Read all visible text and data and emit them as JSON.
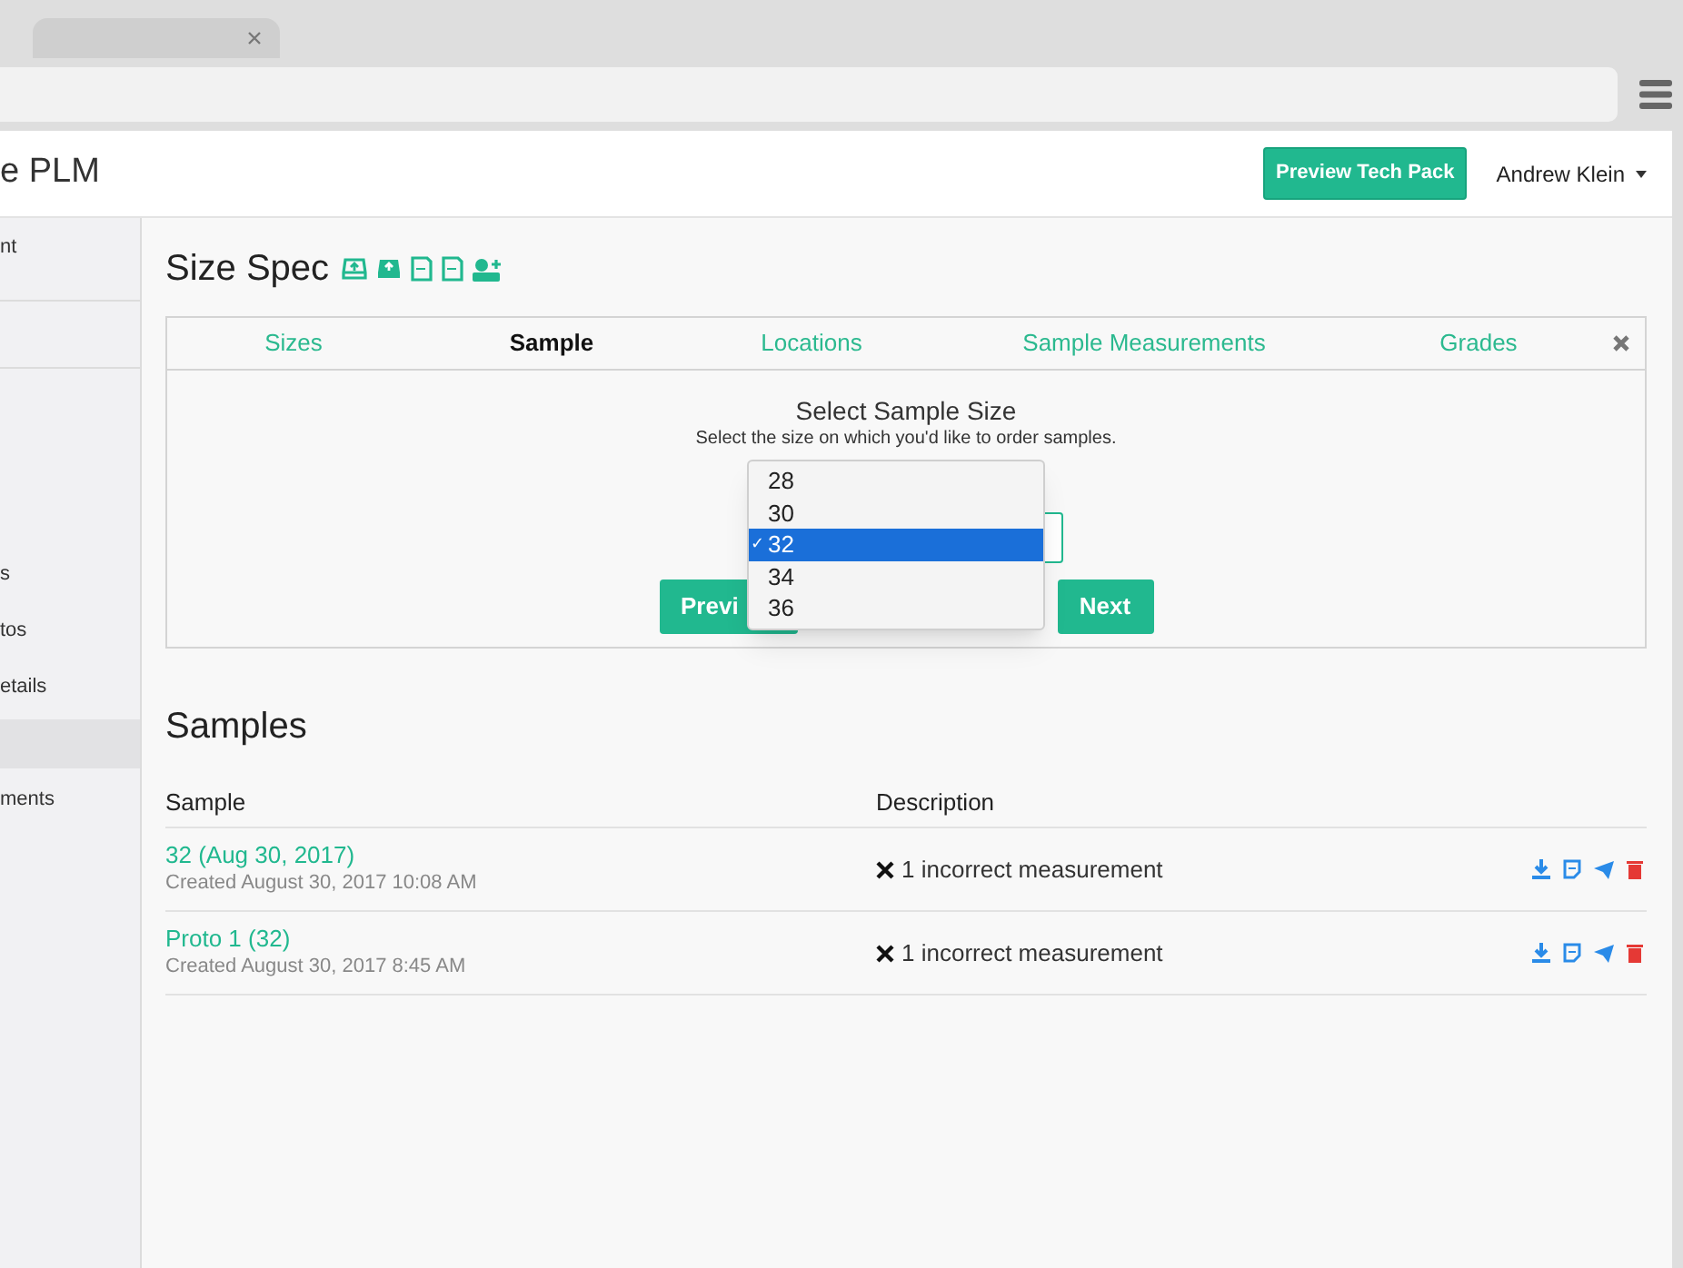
{
  "app": {
    "title": "e PLM",
    "preview_button": "Preview Tech Pack",
    "user": "Andrew Klein"
  },
  "sidebar": {
    "items": [
      {
        "label": "nt",
        "selected": false
      },
      {
        "label": "s",
        "selected": false
      },
      {
        "label": "tos",
        "selected": false
      },
      {
        "label": "etails",
        "selected": false
      },
      {
        "selected": true
      },
      {
        "label": "ments",
        "selected": false
      }
    ]
  },
  "size_spec": {
    "title": "Size Spec",
    "tabs": [
      {
        "label": "Sizes",
        "selected": false
      },
      {
        "label": "Sample",
        "selected": true
      },
      {
        "label": "Locations",
        "selected": false
      },
      {
        "label": "Sample Measurements",
        "selected": false
      },
      {
        "label": "Grades",
        "selected": false
      }
    ],
    "heading": "Select Sample Size",
    "subheading": "Select the size on which you'd like to order samples.",
    "dropdown": {
      "check_mark": "✓",
      "options": [
        {
          "label": "28",
          "selected": false
        },
        {
          "label": "30",
          "selected": false
        },
        {
          "label": "32",
          "selected": true
        },
        {
          "label": "34",
          "selected": false
        },
        {
          "label": "36",
          "selected": false
        }
      ]
    },
    "previous_button": "Previ",
    "next_button": "Next"
  },
  "samples": {
    "title": "Samples",
    "columns": [
      "Sample",
      "Description"
    ],
    "rows": [
      {
        "name": "32 (Aug 30, 2017)",
        "created": "Created August 30, 2017 10:08 AM",
        "description": "1 incorrect measurement"
      },
      {
        "name": "Proto 1 (32)",
        "created": "Created August 30, 2017 8:45 AM",
        "description": "1 incorrect measurement"
      }
    ]
  }
}
